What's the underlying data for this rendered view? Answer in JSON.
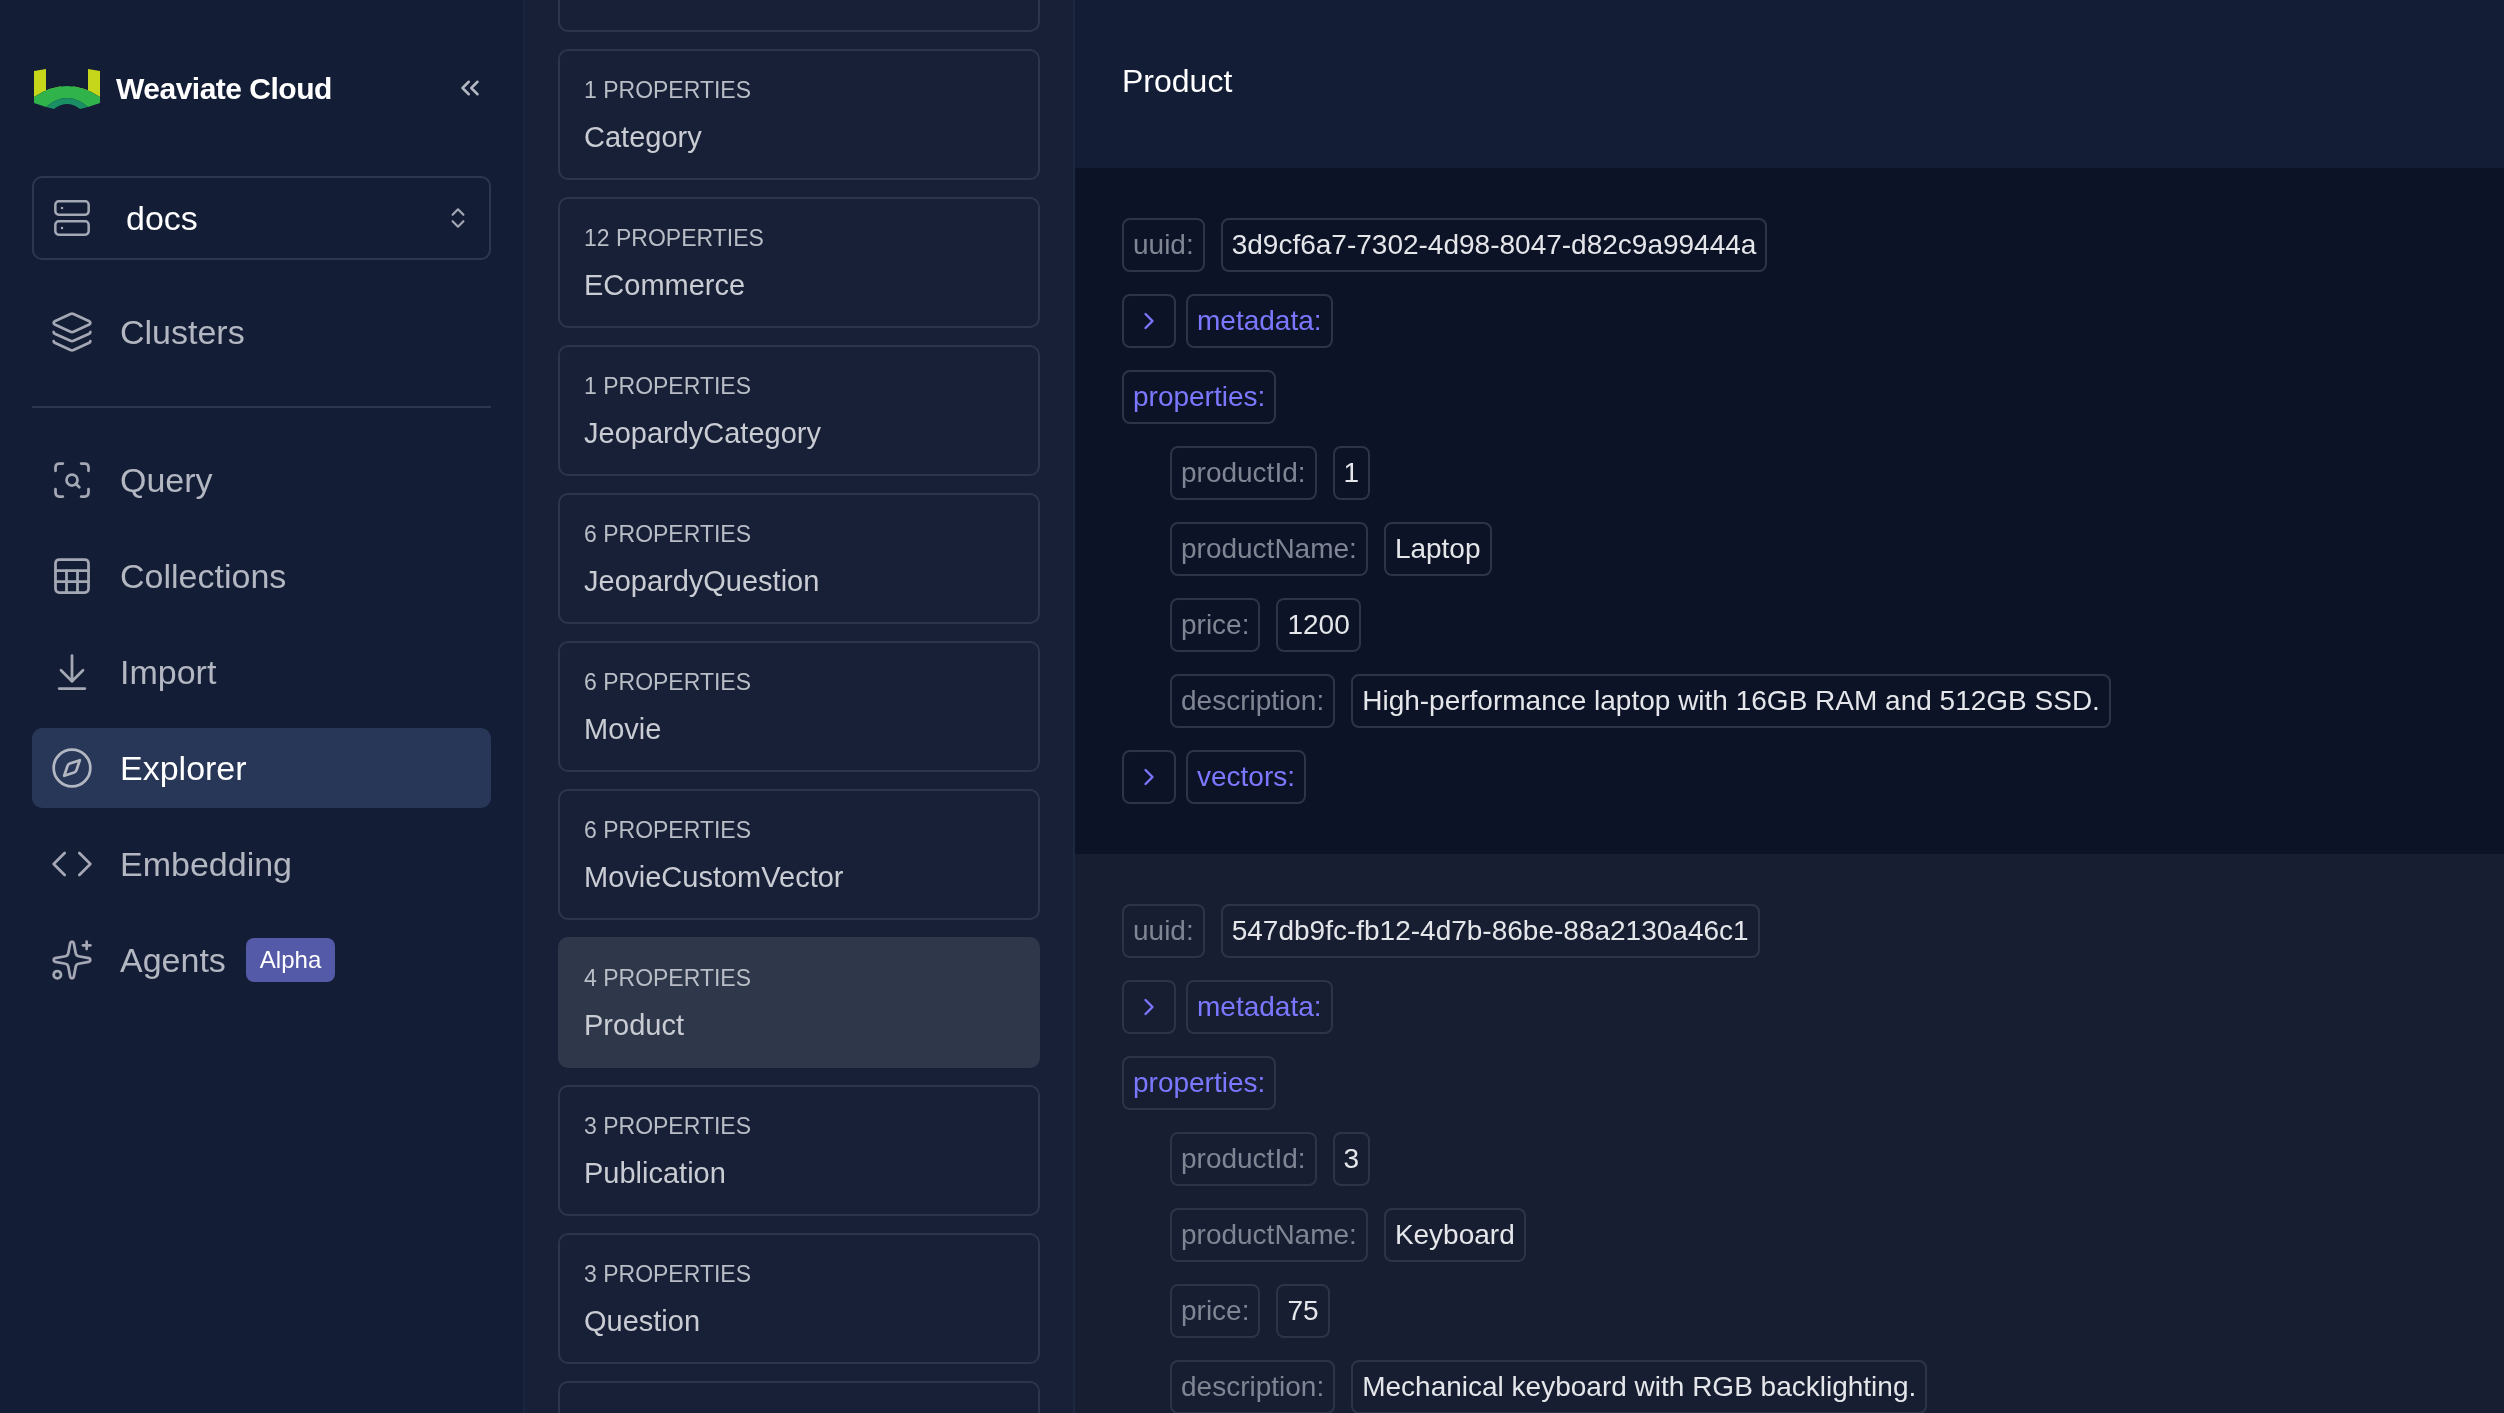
{
  "brand": {
    "name": "Weaviate Cloud"
  },
  "cluster_select": {
    "value": "docs"
  },
  "top_nav": [
    {
      "label": "Clusters",
      "selected": false
    }
  ],
  "nav": [
    {
      "label": "Query",
      "selected": false
    },
    {
      "label": "Collections",
      "selected": false
    },
    {
      "label": "Import",
      "selected": false
    },
    {
      "label": "Explorer",
      "selected": true
    },
    {
      "label": "Embedding",
      "selected": false
    },
    {
      "label": "Agents",
      "selected": false,
      "badge": "Alpha"
    }
  ],
  "collections": [
    {
      "count": "1 PROPERTIES",
      "name": "Category",
      "selected": false
    },
    {
      "count": "12 PROPERTIES",
      "name": "ECommerce",
      "selected": false
    },
    {
      "count": "1 PROPERTIES",
      "name": "JeopardyCategory",
      "selected": false
    },
    {
      "count": "6 PROPERTIES",
      "name": "JeopardyQuestion",
      "selected": false
    },
    {
      "count": "6 PROPERTIES",
      "name": "Movie",
      "selected": false
    },
    {
      "count": "6 PROPERTIES",
      "name": "MovieCustomVector",
      "selected": false
    },
    {
      "count": "4 PROPERTIES",
      "name": "Product",
      "selected": true
    },
    {
      "count": "3 PROPERTIES",
      "name": "Publication",
      "selected": false
    },
    {
      "count": "3 PROPERTIES",
      "name": "Question",
      "selected": false
    }
  ],
  "detail": {
    "title": "Product",
    "objects": [
      {
        "uuid_label": "uuid:",
        "uuid": "3d9cf6a7-7302-4d98-8047-d82c9a99444a",
        "metadata_label": "metadata:",
        "metadata_expanded": false,
        "properties_label": "properties:",
        "properties": [
          {
            "key": "productId:",
            "value": "1"
          },
          {
            "key": "productName:",
            "value": "Laptop"
          },
          {
            "key": "price:",
            "value": "1200"
          },
          {
            "key": "description:",
            "value": "High-performance laptop with 16GB RAM and 512GB SSD."
          }
        ],
        "vectors_label": "vectors:",
        "vectors_expanded": false
      },
      {
        "uuid_label": "uuid:",
        "uuid": "547db9fc-fb12-4d7b-86be-88a2130a46c1",
        "metadata_label": "metadata:",
        "metadata_expanded": false,
        "properties_label": "properties:",
        "properties": [
          {
            "key": "productId:",
            "value": "3"
          },
          {
            "key": "productName:",
            "value": "Keyboard"
          },
          {
            "key": "price:",
            "value": "75"
          },
          {
            "key": "description:",
            "value": "Mechanical keyboard with RGB backlighting."
          }
        ]
      }
    ]
  }
}
